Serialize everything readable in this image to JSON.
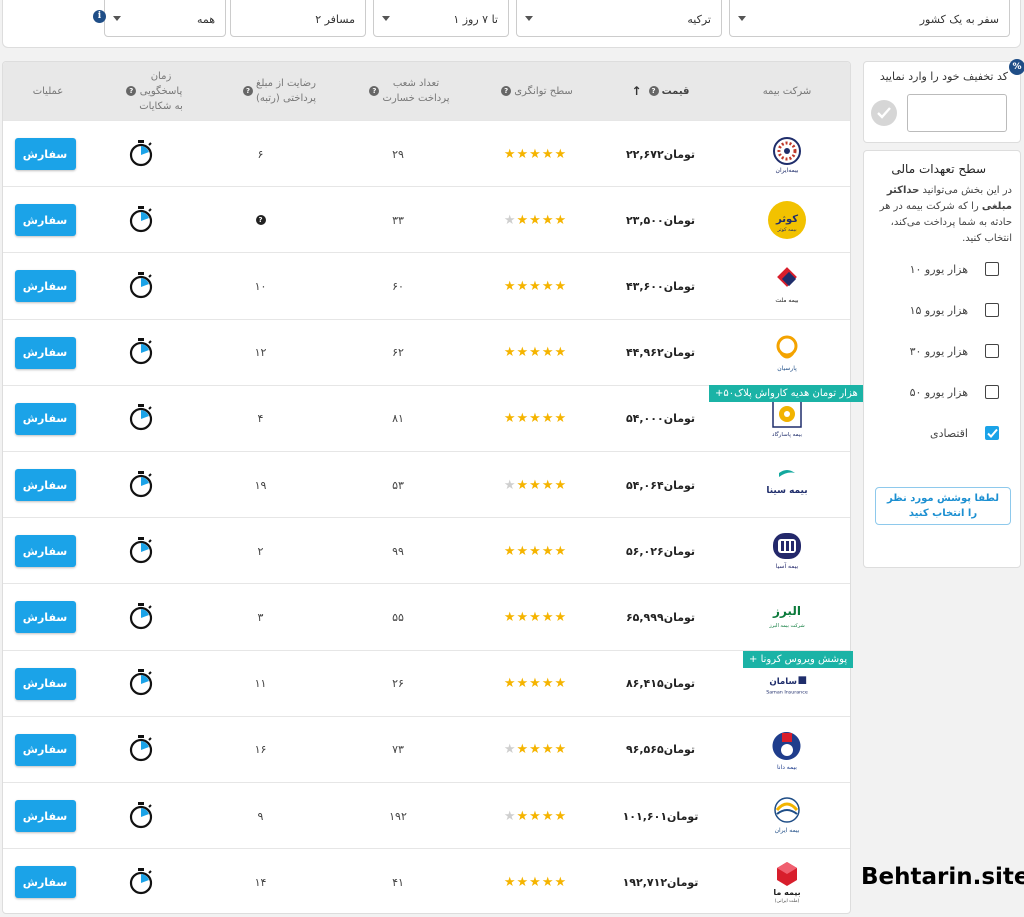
{
  "filters": {
    "country_type": "سفر به یک کشور",
    "destination": "ترکیه",
    "duration": "۱ تا ۷ روز",
    "travelers": "۲ مسافر",
    "age": "همه",
    "info_icon": "i"
  },
  "table": {
    "headers": {
      "company": "شرکت بیمه",
      "price": "قیمت",
      "capacity": "سطح توانگری",
      "branches_line1": "تعداد شعب",
      "branches_line2": "پرداخت خسارت",
      "satisfaction_line1": "رضایت از مبلغ",
      "satisfaction_line2": "پرداختی (رتبه)",
      "response_line1": "زمان",
      "response_line2": "پاسخگویی",
      "response_line3": "به شکایات",
      "actions": "عملیات"
    },
    "order_label": "سفارش",
    "rows": [
      {
        "price": "۲۲,۶۷۲تومان",
        "stars": 5,
        "branches": "۲۹",
        "satisfaction": "۶",
        "logo": "saman-style-logo",
        "color": "#1f2d6b"
      },
      {
        "price": "۲۳,۵۰۰تومان",
        "stars": 4,
        "branches": "۳۳",
        "satisfaction": "?",
        "logo": "kowsar-logo",
        "color": "#f2c200"
      },
      {
        "price": "۴۳,۶۰۰تومان",
        "stars": 5,
        "branches": "۶۰",
        "satisfaction": "۱۰",
        "logo": "mellat-logo",
        "color": "#d81e2c"
      },
      {
        "price": "۴۴,۹۶۲تومان",
        "stars": 5,
        "branches": "۶۲",
        "satisfaction": "۱۲",
        "logo": "parsian-logo",
        "color": "#f4a300"
      },
      {
        "price": "۵۴,۰۰۰تومان",
        "stars": 5,
        "branches": "۸۱",
        "satisfaction": "۴",
        "logo": "pasargad-logo",
        "color": "#f2b300"
      },
      {
        "price": "۵۴,۰۶۴تومان",
        "stars": 4,
        "branches": "۵۳",
        "satisfaction": "۱۹",
        "logo": "sina-logo",
        "color": "#13a89e"
      },
      {
        "price": "۵۶,۰۲۶تومان",
        "stars": 5,
        "branches": "۹۹",
        "satisfaction": "۲",
        "logo": "asia-logo",
        "color": "#23286b"
      },
      {
        "price": "۶۵,۹۹۹تومان",
        "stars": 5,
        "branches": "۵۵",
        "satisfaction": "۳",
        "logo": "alborz-logo",
        "color": "#0b7a3b"
      },
      {
        "price": "۸۶,۴۱۵تومان",
        "stars": 5,
        "branches": "۲۶",
        "satisfaction": "۱۱",
        "logo": "saman-logo",
        "color": "#1f2d6b"
      },
      {
        "price": "۹۶,۵۶۵تومان",
        "stars": 4,
        "branches": "۷۳",
        "satisfaction": "۱۶",
        "logo": "dana-logo",
        "color": "#1f3d8c"
      },
      {
        "price": "۱۰۱,۶۰۱تومان",
        "stars": 4,
        "branches": "۱۹۲",
        "satisfaction": "۹",
        "logo": "iran-logo",
        "color": "#1f4e87"
      },
      {
        "price": "۱۹۲,۷۱۲تومان",
        "stars": 5,
        "branches": "۴۱",
        "satisfaction": "۱۴",
        "logo": "ma-logo",
        "color": "#d81e2c"
      }
    ],
    "logo_texts": {
      "saman_style": "بیمه‌ایران",
      "kowsar": "کوثر",
      "kowsar_sub": "بیمه کوثر",
      "mellat": "بیمه ملت",
      "parsian": "پارسیان",
      "pasargad": "بیمه پاسارگاد",
      "sina": "بیمه سینا",
      "asia": "بیمه آسیا",
      "alborz": "البرز",
      "alborz_sub": "شرکت بیمه البرز",
      "saman": "سامان",
      "saman_en": "Saman Insurance",
      "dana": "بیمه دانا",
      "iran": "بیمه ایران",
      "ma": "بیمه ما",
      "ma_sub": "(ملت ایرانی)"
    }
  },
  "badges": {
    "pasargad_gift": "+۵۰هزار تومان هدیه کارواش پلاک",
    "saman_corona": "+ پوشش ویروس کرونا"
  },
  "discount": {
    "label": "کد تخفیف خود را وارد نمایید",
    "placeholder": "",
    "icon": "%"
  },
  "coverage": {
    "title": "سطح تعهدات مالی",
    "desc_part1": "در این بخش می‌توانید ",
    "desc_bold": "حداکثر مبلغی",
    "desc_part2": " را که شرکت بیمه در هر حادثه به شما پرداخت می‌کند، انتخاب کنید.",
    "options": [
      {
        "label": "۱۰ هزار یورو",
        "checked": false
      },
      {
        "label": "۱۵ هزار یورو",
        "checked": false
      },
      {
        "label": "۳۰ هزار یورو",
        "checked": false
      },
      {
        "label": "۵۰ هزار یورو",
        "checked": false
      },
      {
        "label": "اقتصادی",
        "checked": true
      }
    ],
    "select_button": "لطفا پوشش مورد نظر را انتخاب کنید"
  },
  "watermark": "Behtarin.site",
  "colors": {
    "accent": "#1ba3e8",
    "star": "#f5b400",
    "badge": "#1bb3a6"
  }
}
